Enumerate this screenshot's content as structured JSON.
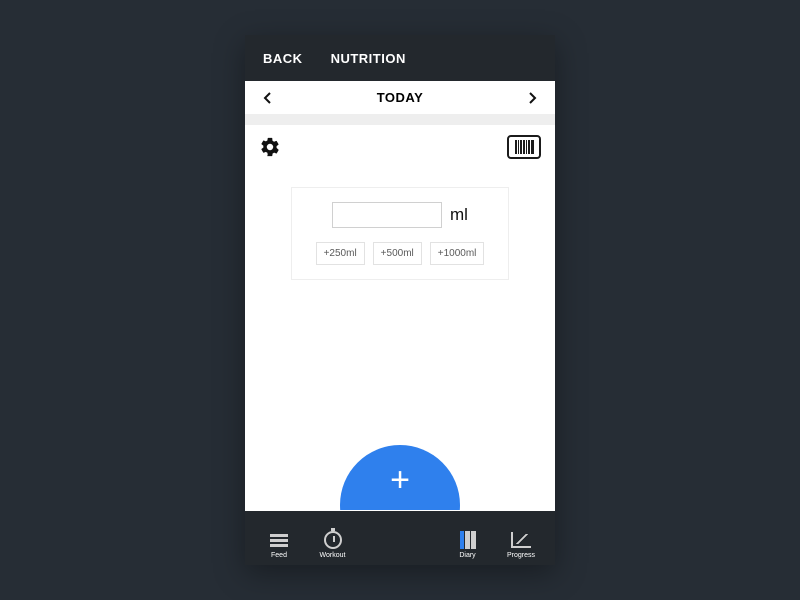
{
  "topbar": {
    "back": "BACK",
    "title": "NUTRITION"
  },
  "datebar": {
    "label": "TODAY"
  },
  "water": {
    "value": "",
    "unit": "ml",
    "presets": [
      "+250ml",
      "+500ml",
      "+1000ml"
    ]
  },
  "tabs": {
    "feed": "Feed",
    "workout": "Workout",
    "diary": "Diary",
    "progress": "Progress"
  },
  "colors": {
    "accent": "#2f80ed",
    "dark": "#23282d"
  }
}
